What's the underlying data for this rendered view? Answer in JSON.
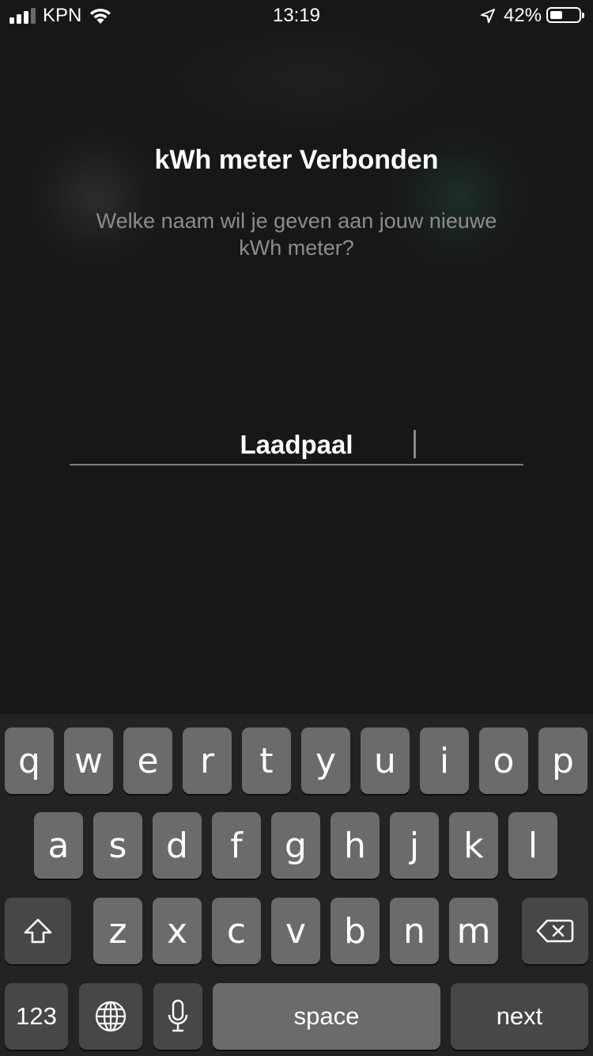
{
  "status_bar": {
    "carrier": "KPN",
    "time": "13:19",
    "battery_percent": "42%",
    "battery_level": 0.42,
    "signal_bars": 3,
    "icons": [
      "signal-icon",
      "wifi-icon",
      "location-icon",
      "battery-icon"
    ]
  },
  "screen": {
    "title": "kWh meter Verbonden",
    "subtitle": "Welke naam wil je geven aan jouw nieuwe kWh meter?",
    "name_input": {
      "value": "Laadpaal",
      "placeholder": ""
    }
  },
  "keyboard": {
    "row1": [
      "q",
      "w",
      "e",
      "r",
      "t",
      "y",
      "u",
      "i",
      "o",
      "p"
    ],
    "row2": [
      "a",
      "s",
      "d",
      "f",
      "g",
      "h",
      "j",
      "k",
      "l"
    ],
    "row3": [
      "z",
      "x",
      "c",
      "v",
      "b",
      "n",
      "m"
    ],
    "numbers_label": "123",
    "space_label": "space",
    "return_label": "next",
    "icons": [
      "shift-icon",
      "backspace-icon",
      "globe-icon",
      "microphone-icon"
    ]
  },
  "colors": {
    "background": "#171717",
    "keyboard": "#232323",
    "key": "#6b6b6b",
    "key_dark": "#474747",
    "subtitle": "#8d8d8d"
  }
}
